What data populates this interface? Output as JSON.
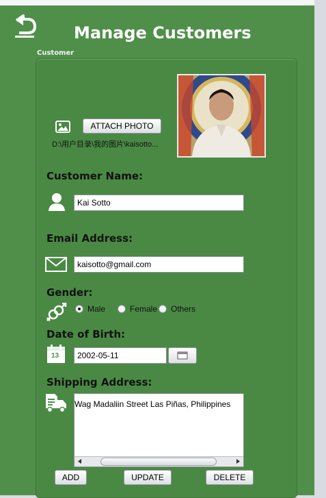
{
  "window": {
    "title": "Manage Customers"
  },
  "section": {
    "label": "Customer"
  },
  "photo": {
    "attach_label": "ATTACH PHOTO",
    "path": "D:\\用户目录\\我的图片\\kaisotto..."
  },
  "customer_name": {
    "label": "Customer Name:",
    "value": "Kai Sotto"
  },
  "email": {
    "label": "Email Address:",
    "value": "kaisotto@gmail.com"
  },
  "gender": {
    "label": "Gender:",
    "options": [
      "Male",
      "Female",
      "Others"
    ],
    "selected": "Male"
  },
  "dob": {
    "label": "Date of Birth:",
    "value": "2002-05-11",
    "calendar_icon_text": "13"
  },
  "shipping": {
    "label": "Shipping Address:",
    "value": "Wag Madaliin Street  Las Piñas, Philippines"
  },
  "actions": {
    "add": "ADD",
    "update": "UPDATE",
    "delete": "DELETE"
  },
  "colors": {
    "background": "#4f8f4a",
    "panel": "#4a8944",
    "title_text": "#ffffff"
  }
}
